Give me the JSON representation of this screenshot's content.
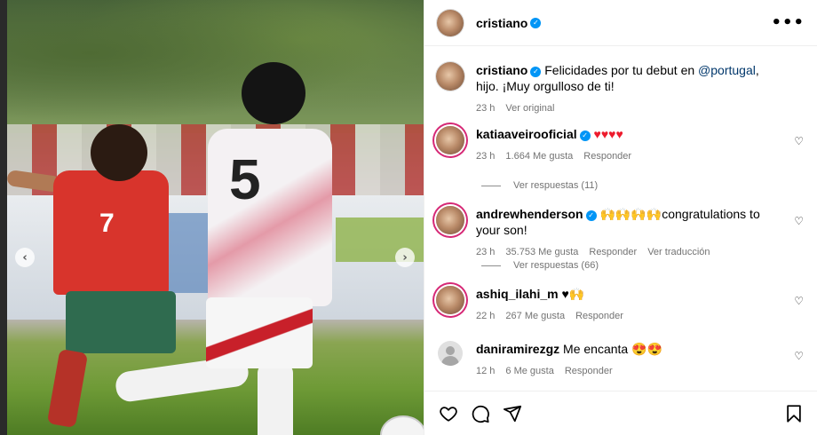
{
  "header": {
    "username": "cristiano",
    "more_label": "•••"
  },
  "photo": {
    "prev_label": "‹",
    "next_label": "›",
    "player_left_number": "7",
    "player_right_number": "5"
  },
  "caption": {
    "username": "cristiano",
    "text_before": " Felicidades por tu debut en ",
    "mention": "@portugal",
    "text_after": ", hijo. ¡Muy orgulloso de ti!",
    "time": "23 h",
    "translate": "Ver original"
  },
  "comments": [
    {
      "username": "katiaaveirooficial",
      "text": "♥♥♥♥",
      "time": "23 h",
      "likes": "1.664 Me gusta",
      "reply": "Responder",
      "replies": "Ver respuestas (11)",
      "translate": ""
    },
    {
      "username": "andrewhenderson",
      "text": "🙌🙌🙌🙌congratulations to your son!",
      "time": "23 h",
      "likes": "35.753 Me gusta",
      "reply": "Responder",
      "replies": "Ver respuestas (66)",
      "translate": "Ver traducción"
    },
    {
      "username": "ashiq_ilahi_m",
      "text": "♥🙌",
      "time": "22 h",
      "likes": "267 Me gusta",
      "reply": "Responder",
      "replies": "",
      "translate": ""
    },
    {
      "username": "daniramirezgz",
      "text": "Me encanta 😍😍",
      "time": "12 h",
      "likes": "6 Me gusta",
      "reply": "Responder",
      "replies": "",
      "translate": ""
    }
  ],
  "icons": {
    "like": "heart-icon",
    "comment": "comment-icon",
    "share": "share-icon",
    "save": "bookmark-icon"
  },
  "colors": {
    "verified": "#0095f6",
    "mention": "#00376b",
    "muted": "#737373",
    "story_ring": "#d62976"
  }
}
